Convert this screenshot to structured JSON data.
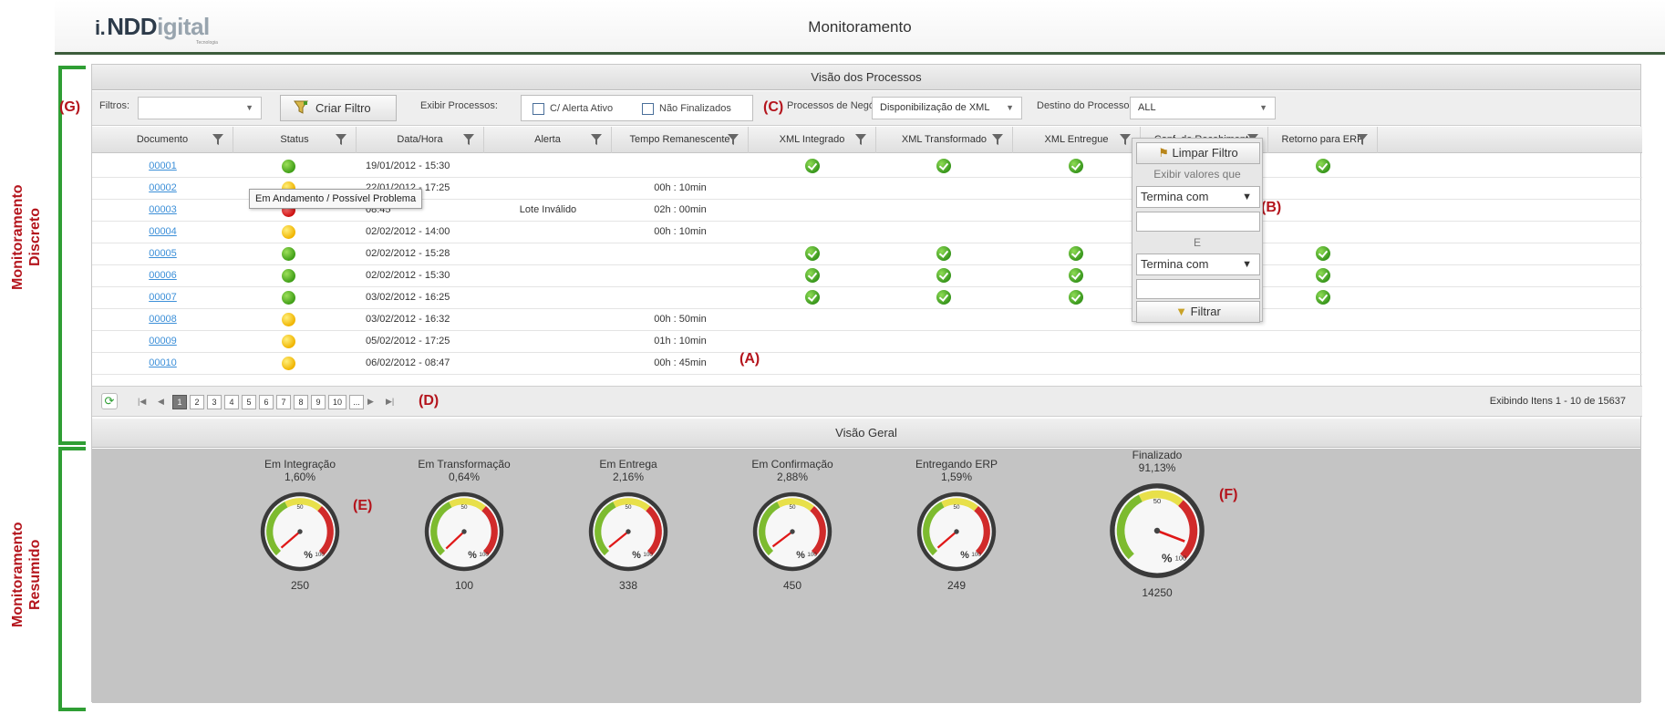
{
  "header": {
    "logo_main": "NDD",
    "logo_light": "igital",
    "logo_sub": "Tecnologia",
    "title": "Monitoramento"
  },
  "side_labels": {
    "discreto": "Monitoramento Discreto",
    "resumido": "Monitoramento Resumido"
  },
  "process_panel": {
    "title": "Visão dos Processos"
  },
  "toolbar": {
    "filtros_label": "Filtros:",
    "filtros_value": "",
    "criar_filtro": "Criar Filtro",
    "exibir_label": "Exibir Processos:",
    "chk_alerta": "C/ Alerta Ativo",
    "chk_nao_finalizados": "Não Finalizados",
    "processos_label": "Processos de Negócio:",
    "processos_value": "Disponibilização de XML",
    "destino_label": "Destino do Processo:",
    "destino_value": "ALL"
  },
  "annotations": {
    "g": "(G)",
    "c": "(C)",
    "b": "(B)",
    "a": "(A)",
    "d": "(D)",
    "e": "(E)",
    "f": "(F)"
  },
  "columns": [
    "Documento",
    "Status",
    "Data/Hora",
    "Alerta",
    "Tempo Remanescente",
    "XML Integrado",
    "XML Transformado",
    "XML Entregue",
    "Conf. de Recebimento",
    "Retorno para ERP"
  ],
  "rows": [
    {
      "doc": "00001",
      "status": "green",
      "datetime": "19/01/2012 - 15:30",
      "alerta": "",
      "tempo": "",
      "integrado": true,
      "transformado": true,
      "entregue": true,
      "erp": true
    },
    {
      "doc": "00002",
      "status": "yellow",
      "datetime": "22/01/2012 - 17:25",
      "alerta": "",
      "tempo": "00h : 10min",
      "integrado": false,
      "transformado": false,
      "entregue": false,
      "erp": false
    },
    {
      "doc": "00003",
      "status": "red",
      "datetime": "08:45",
      "alerta": "Lote Inválido",
      "tempo": "02h : 00min",
      "integrado": false,
      "transformado": false,
      "entregue": false,
      "erp": false
    },
    {
      "doc": "00004",
      "status": "yellow",
      "datetime": "02/02/2012 - 14:00",
      "alerta": "",
      "tempo": "00h : 10min",
      "integrado": false,
      "transformado": false,
      "entregue": false,
      "erp": false
    },
    {
      "doc": "00005",
      "status": "green",
      "datetime": "02/02/2012 - 15:28",
      "alerta": "",
      "tempo": "",
      "integrado": true,
      "transformado": true,
      "entregue": true,
      "erp": true
    },
    {
      "doc": "00006",
      "status": "green",
      "datetime": "02/02/2012 - 15:30",
      "alerta": "",
      "tempo": "",
      "integrado": true,
      "transformado": true,
      "entregue": true,
      "erp": true
    },
    {
      "doc": "00007",
      "status": "green",
      "datetime": "03/02/2012 - 16:25",
      "alerta": "",
      "tempo": "",
      "integrado": true,
      "transformado": true,
      "entregue": true,
      "erp": true
    },
    {
      "doc": "00008",
      "status": "yellow",
      "datetime": "03/02/2012 - 16:32",
      "alerta": "",
      "tempo": "00h : 50min",
      "integrado": false,
      "transformado": false,
      "entregue": false,
      "erp": false
    },
    {
      "doc": "00009",
      "status": "yellow",
      "datetime": "05/02/2012 - 17:25",
      "alerta": "",
      "tempo": "01h : 10min",
      "integrado": false,
      "transformado": false,
      "entregue": false,
      "erp": false
    },
    {
      "doc": "00010",
      "status": "yellow",
      "datetime": "06/02/2012 - 08:47",
      "alerta": "",
      "tempo": "00h : 45min",
      "integrado": false,
      "transformado": false,
      "entregue": false,
      "erp": false
    }
  ],
  "tooltip": "Em Andamento / Possível Problema",
  "filter_popup": {
    "limpar": "Limpar Filtro",
    "exibir_valores": "Exibir valores que",
    "op1": "Termina com",
    "and_label": "E",
    "op2": "Termina com",
    "filtrar": "Filtrar"
  },
  "pager": {
    "pages": [
      "1",
      "2",
      "3",
      "4",
      "5",
      "6",
      "7",
      "8",
      "9",
      "10",
      "..."
    ],
    "active_page": "1",
    "info": "Exibindo Itens 1 - 10 de 15637"
  },
  "overview": {
    "title": "Visão Geral",
    "gauges": [
      {
        "name": "Em Integração",
        "pct": "1,60%",
        "count": "250",
        "value": 1.6
      },
      {
        "name": "Em Transformação",
        "pct": "0,64%",
        "count": "100",
        "value": 0.64
      },
      {
        "name": "Em Entrega",
        "pct": "2,16%",
        "count": "338",
        "value": 2.16
      },
      {
        "name": "Em Confirmação",
        "pct": "2,88%",
        "count": "450",
        "value": 2.88
      },
      {
        "name": "Entregando ERP",
        "pct": "1,59%",
        "count": "249",
        "value": 1.59
      },
      {
        "name": "Finalizado",
        "pct": "91,13%",
        "count": "14250",
        "value": 91.13
      }
    ],
    "gauge_labels": {
      "mid": "50",
      "max": "100",
      "unit": "%"
    }
  },
  "colors": {
    "accent_green": "#2f9e34",
    "annotation_red": "#b4141c",
    "link_blue": "#3c8fd8"
  }
}
